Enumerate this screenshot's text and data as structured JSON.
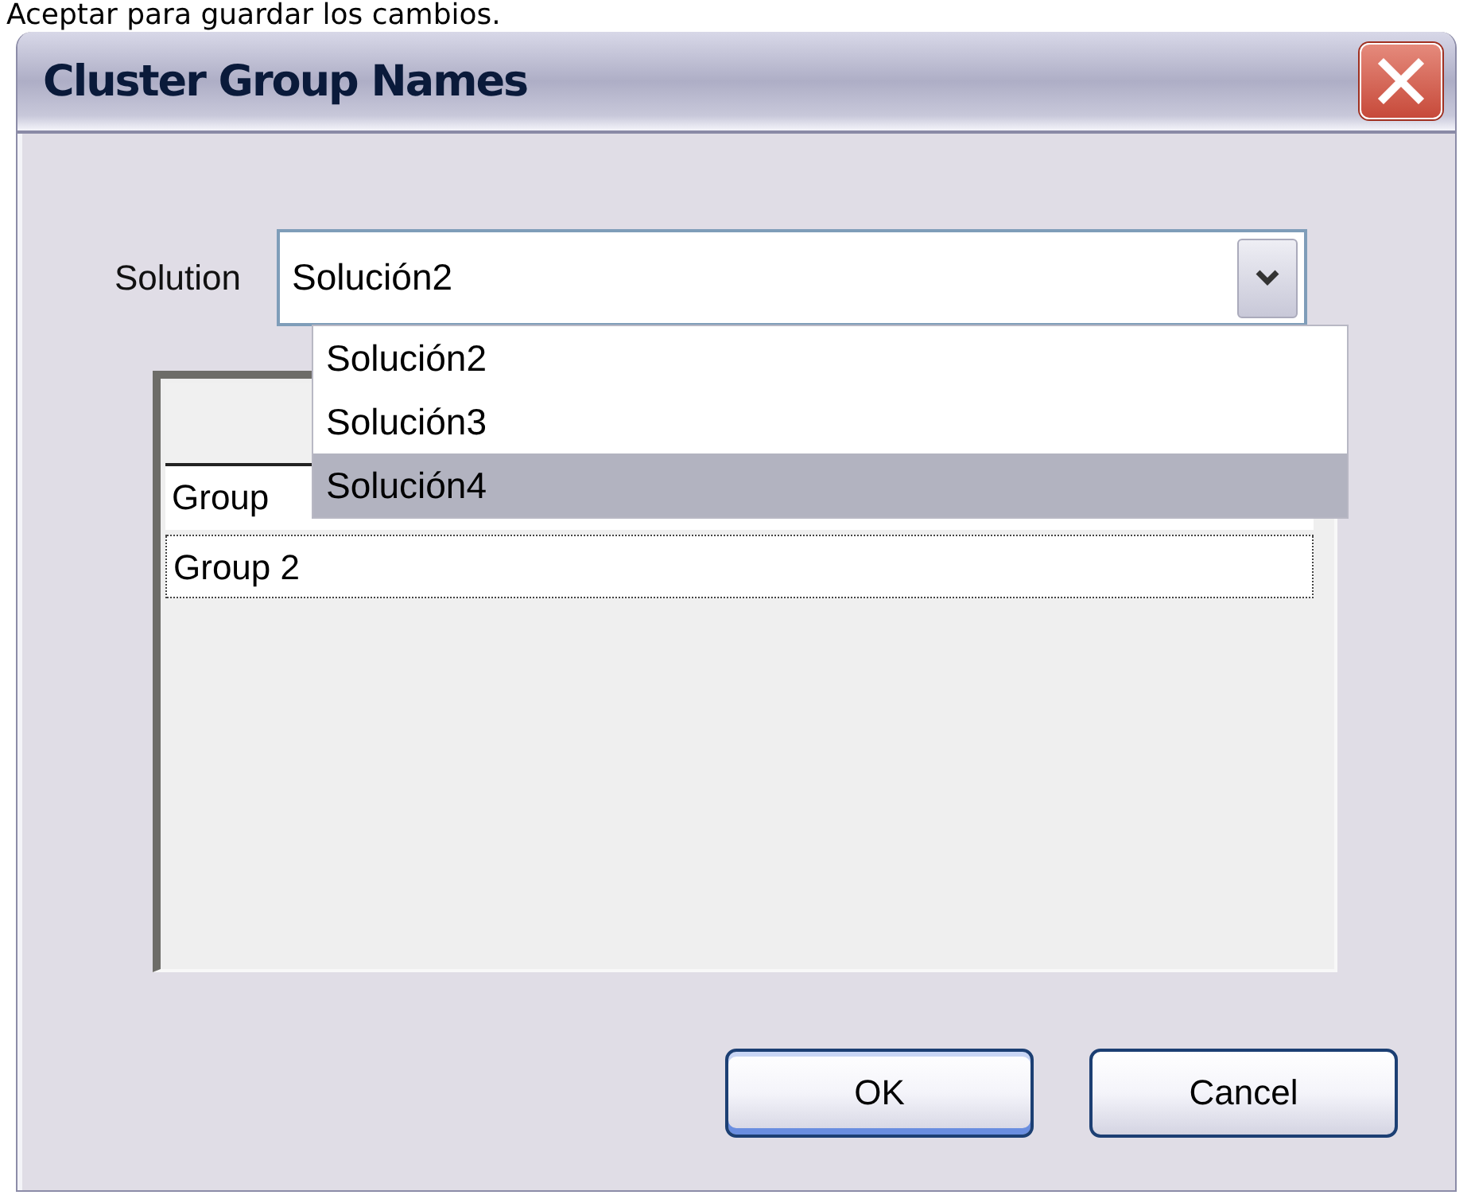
{
  "caption": "Aceptar para guardar los cambios.",
  "window": {
    "title": "Cluster Group Names"
  },
  "solution": {
    "label": "Solution",
    "value": "Solución2",
    "expanded": true,
    "options": [
      {
        "label": "Solución2",
        "highlighted": false
      },
      {
        "label": "Solución3",
        "highlighted": false
      },
      {
        "label": "Solución4",
        "highlighted": true
      }
    ]
  },
  "grid": {
    "rows": [
      {
        "name": "Group",
        "focused": false
      },
      {
        "name": "Group 2",
        "focused": true
      }
    ]
  },
  "buttons": [
    {
      "label": "OK",
      "default": true
    },
    {
      "label": "Cancel",
      "default": false
    }
  ]
}
